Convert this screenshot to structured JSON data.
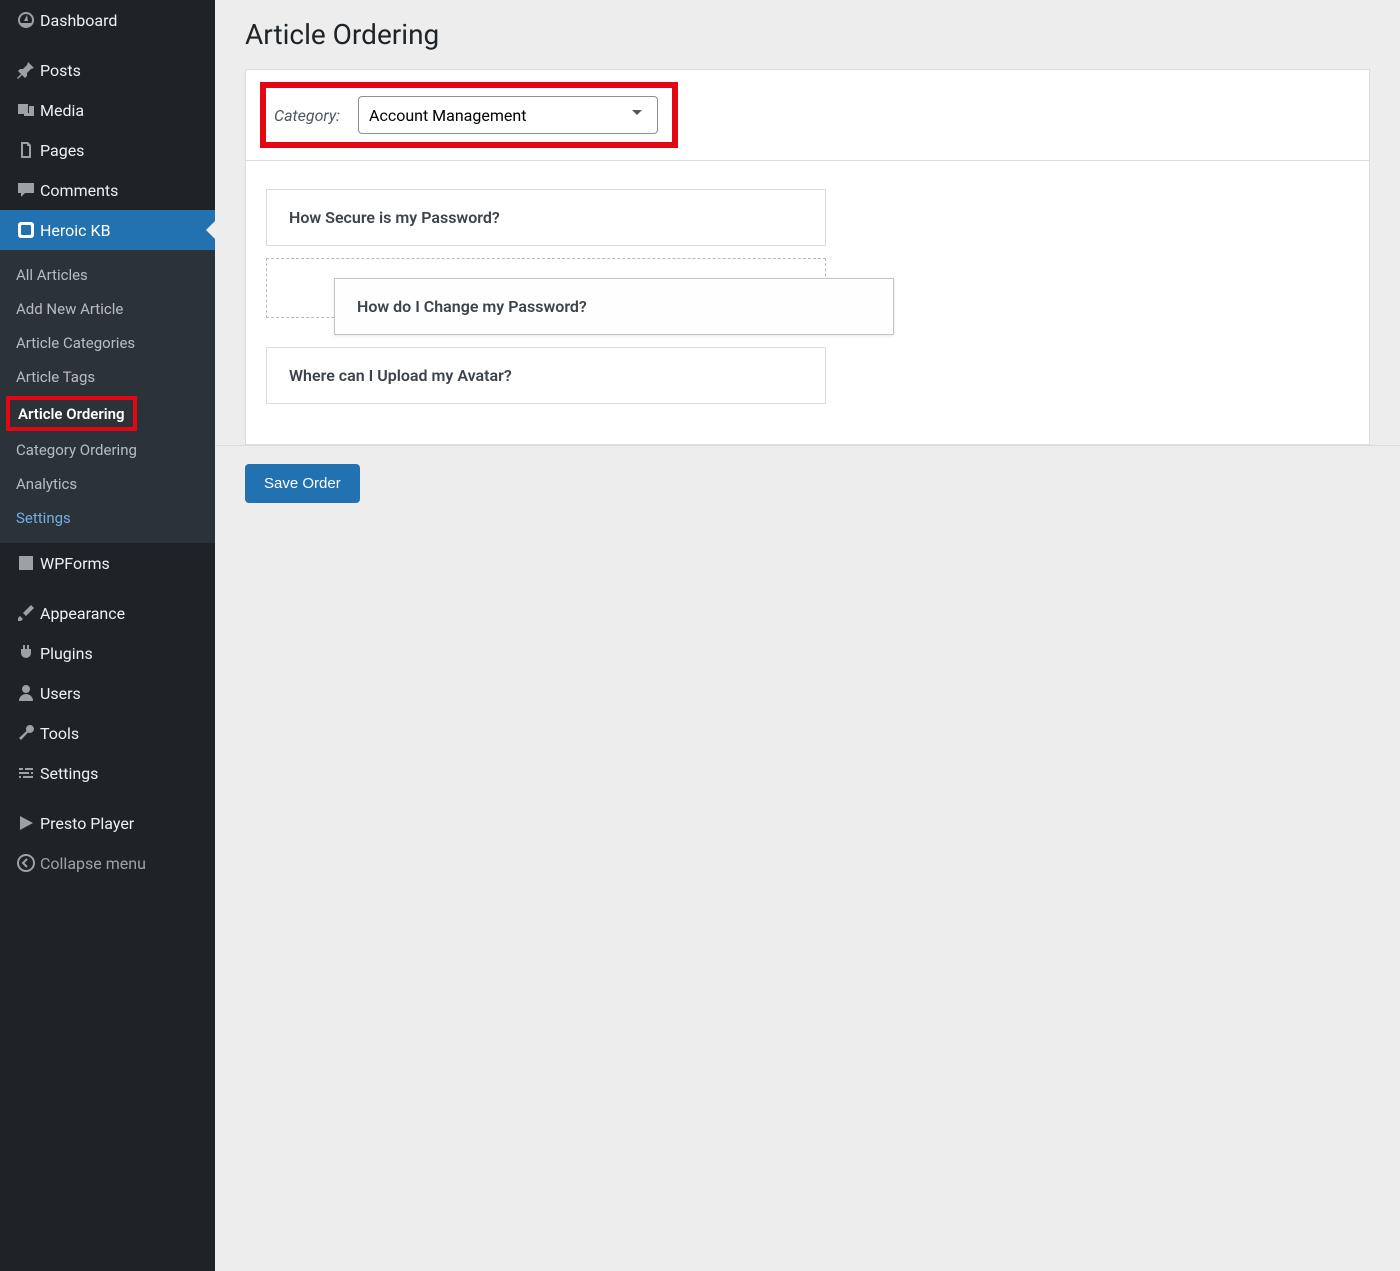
{
  "sidebar": {
    "items": {
      "dashboard": "Dashboard",
      "posts": "Posts",
      "media": "Media",
      "pages": "Pages",
      "comments": "Comments",
      "heroic_kb": "Heroic KB",
      "wpforms": "WPForms",
      "appearance": "Appearance",
      "plugins": "Plugins",
      "users": "Users",
      "tools": "Tools",
      "settings": "Settings",
      "presto": "Presto Player",
      "collapse": "Collapse menu"
    },
    "submenu": {
      "all_articles": "All Articles",
      "add_new": "Add New Article",
      "categories": "Article Categories",
      "tags": "Article Tags",
      "ordering": "Article Ordering",
      "cat_ordering": "Category Ordering",
      "analytics": "Analytics",
      "settings": "Settings"
    }
  },
  "page": {
    "title": "Article Ordering",
    "category_label": "Category:",
    "category_value": "Account Management",
    "save_button": "Save Order"
  },
  "articles": {
    "a0": "How Secure is my Password?",
    "a1": "How do I Change my Password?",
    "a2": "Where can I Upload my Avatar?"
  }
}
